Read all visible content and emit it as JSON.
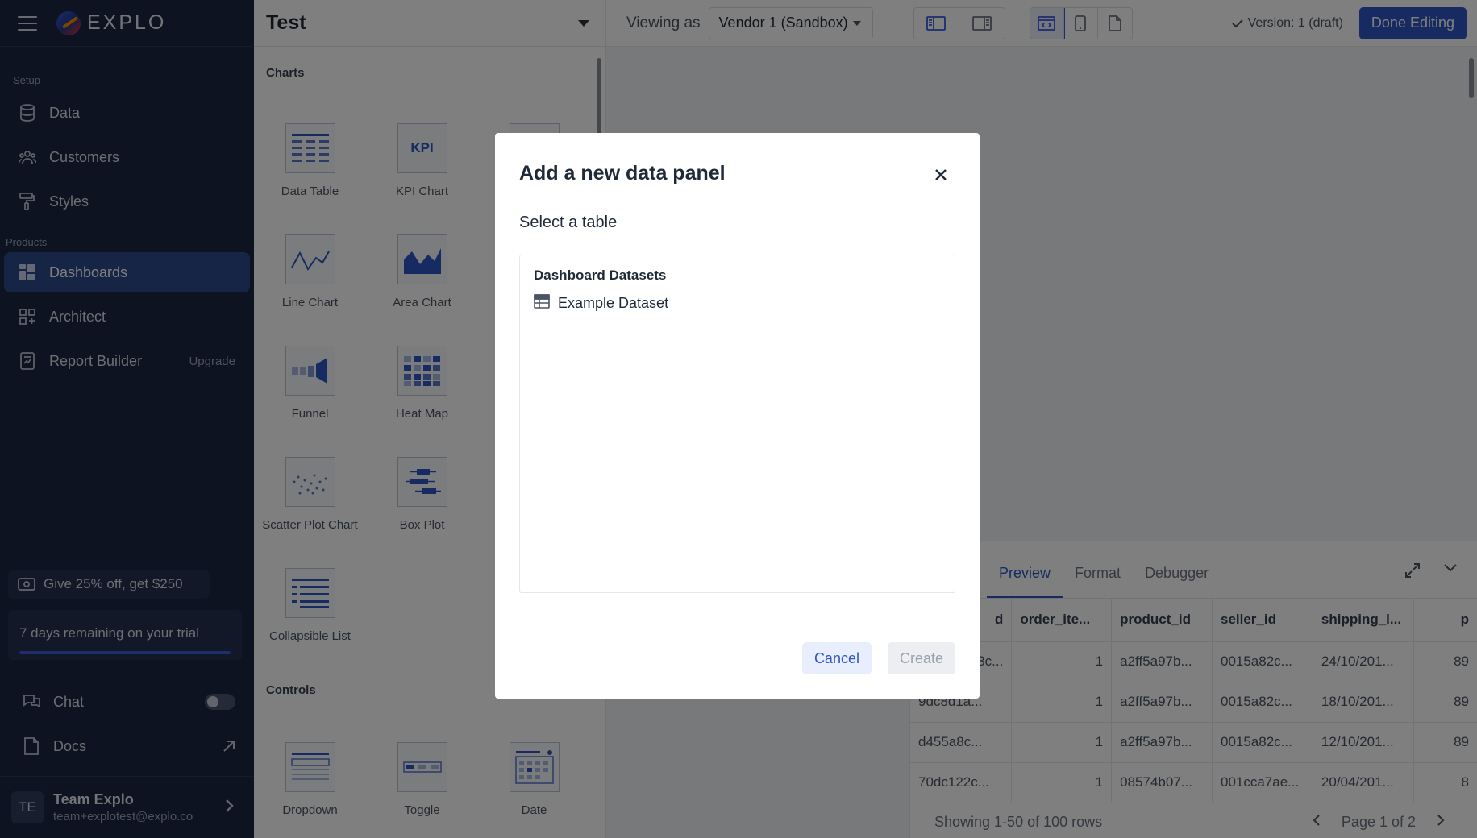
{
  "sidebar": {
    "logo_text": "EXPLO",
    "sections": {
      "setup": "Setup",
      "products": "Products"
    },
    "items": [
      {
        "label": "Data"
      },
      {
        "label": "Customers"
      },
      {
        "label": "Styles"
      },
      {
        "label": "Dashboards"
      },
      {
        "label": "Architect"
      },
      {
        "label": "Report Builder",
        "badge": "Upgrade"
      }
    ],
    "promo": "Give 25% off, get $250",
    "trial": "7 days remaining on your trial",
    "chat": "Chat",
    "docs": "Docs",
    "user": {
      "initials": "TE",
      "name": "Team Explo",
      "email": "team+explotest@explo.co"
    }
  },
  "topbar": {
    "dashboard_title": "Test",
    "viewing_as": "Viewing as",
    "vendor": "Vendor 1 (Sandbox)",
    "version": "Version: 1 (draft)",
    "done": "Done Editing"
  },
  "library": {
    "charts_heading": "Charts",
    "controls_heading": "Controls",
    "charts": [
      {
        "label": "Data Table"
      },
      {
        "label": "KPI Chart",
        "icon_text": "KPI"
      },
      {
        "label": "Line Chart"
      },
      {
        "label": "Area Chart"
      },
      {
        "label": "Funnel"
      },
      {
        "label": "Heat Map"
      },
      {
        "label": "Scatter Plot Chart"
      },
      {
        "label": "Box Plot"
      },
      {
        "label": "Collapsible List"
      }
    ],
    "controls": [
      {
        "label": "Dropdown"
      },
      {
        "label": "Toggle"
      },
      {
        "label": "Date"
      }
    ]
  },
  "data_panel": {
    "tabs": [
      "Preview",
      "Format",
      "Debugger"
    ],
    "columns": [
      "d",
      "order_ite...",
      "product_id",
      "seller_id",
      "shipping_l...",
      "p"
    ],
    "rows": [
      [
        "3c...",
        "1",
        "a2ff5a97b...",
        "0015a82c...",
        "24/10/201...",
        "89"
      ],
      [
        "9dc8d1a...",
        "1",
        "a2ff5a97b...",
        "0015a82c...",
        "18/10/201...",
        "89"
      ],
      [
        "d455a8c...",
        "1",
        "a2ff5a97b...",
        "0015a82c...",
        "12/10/201...",
        "89"
      ],
      [
        "70dc122c...",
        "1",
        "08574b07...",
        "001cca7ae...",
        "20/04/201...",
        "8"
      ]
    ],
    "showing": "Showing 1-50 of 100 rows",
    "page": "Page 1 of 2"
  },
  "modal": {
    "title": "Add a new data panel",
    "subtitle": "Select a table",
    "group": "Dashboard Datasets",
    "dataset": "Example Dataset",
    "cancel": "Cancel",
    "create": "Create"
  },
  "colors": {
    "sidebar_bg": "#1b2640",
    "accent": "#2f56c4",
    "active_item": "#2c4a8a"
  }
}
